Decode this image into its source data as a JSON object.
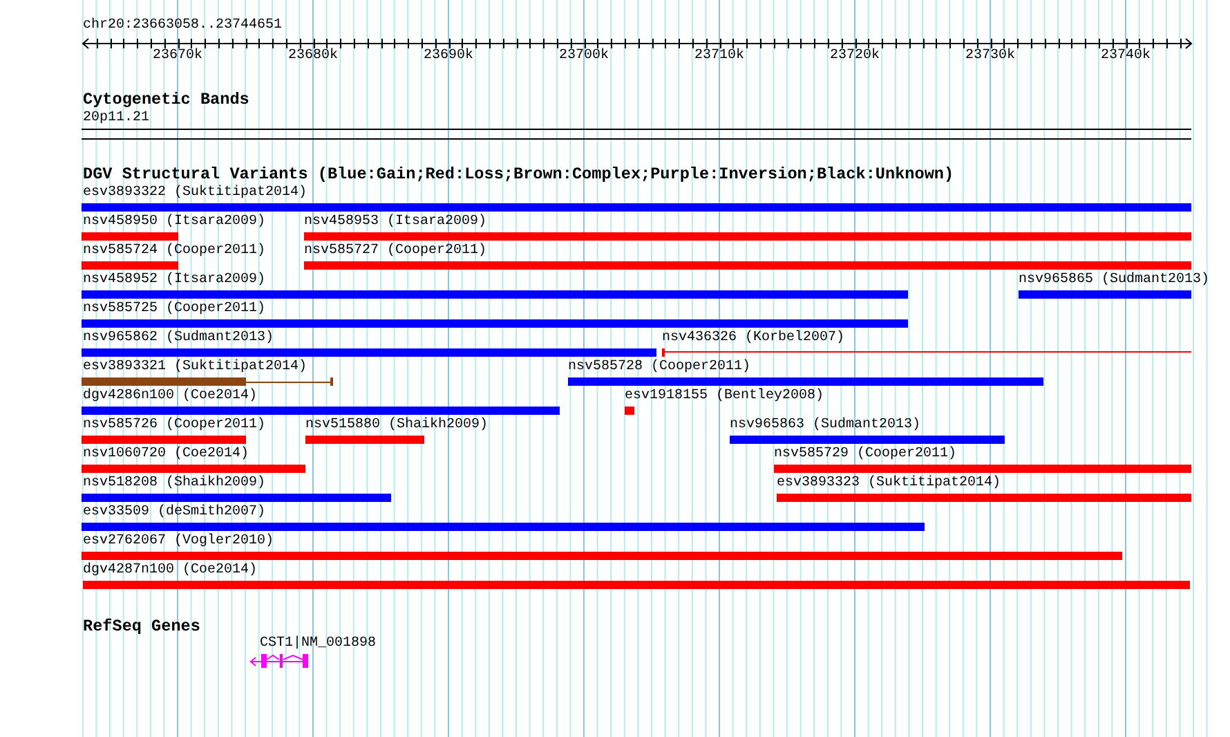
{
  "location": "chr20:23663058..23744651",
  "axis": {
    "ticks": [
      "23670k",
      "23680k",
      "23690k",
      "23700k",
      "23710k",
      "23720k",
      "23730k",
      "23740k"
    ]
  },
  "tracks": [
    {
      "title": "Cytogenetic Bands",
      "kind": "bands",
      "items": [
        {
          "label": "20p11.21"
        }
      ]
    },
    {
      "title": "DGV Structural Variants (Blue:Gain;Red:Loss;Brown:Complex;Purple:Inversion;Black:Unknown)",
      "kind": "variants",
      "lanes": [
        {
          "features": [
            {
              "label": "esv3893322 (Suktitipat2014)",
              "kind": "bar",
              "color": "#0000ff"
            }
          ]
        },
        {
          "features": [
            {
              "label": "nsv458950 (Itsara2009)",
              "kind": "bar",
              "color": "#ff0000"
            },
            {
              "label": "nsv458953 (Itsara2009)",
              "kind": "bar",
              "color": "#ff0000"
            }
          ]
        },
        {
          "features": [
            {
              "label": "nsv585724 (Cooper2011)",
              "kind": "bar",
              "color": "#ff0000"
            },
            {
              "label": "nsv585727 (Cooper2011)",
              "kind": "bar",
              "color": "#ff0000"
            }
          ]
        },
        {
          "features": [
            {
              "label": "nsv458952 (Itsara2009)",
              "kind": "bar",
              "color": "#0000ff"
            },
            {
              "label": "nsv965865 (Sudmant2013)",
              "kind": "bar",
              "color": "#0000ff"
            }
          ]
        },
        {
          "features": [
            {
              "label": "nsv585725 (Cooper2011)",
              "kind": "bar",
              "color": "#0000ff"
            }
          ]
        },
        {
          "features": [
            {
              "label": "nsv965862 (Sudmant2013)",
              "kind": "bar",
              "color": "#0000ff"
            },
            {
              "label": "nsv436326 (Korbel2007)",
              "kind": "thin",
              "color": "#ff0000"
            }
          ]
        },
        {
          "features": [
            {
              "label": "esv3893321 (Suktitipat2014)",
              "kind": "complex",
              "color": "#8b4513"
            },
            {
              "label": "nsv585728 (Cooper2011)",
              "kind": "bar",
              "color": "#0000ff"
            }
          ]
        },
        {
          "features": [
            {
              "label": "dgv4286n100 (Coe2014)",
              "kind": "bar",
              "color": "#0000ff"
            },
            {
              "label": "esv1918155 (Bentley2008)",
              "kind": "bar",
              "color": "#ff0000"
            }
          ]
        },
        {
          "features": [
            {
              "label": "nsv585726 (Cooper2011)",
              "kind": "bar",
              "color": "#ff0000"
            },
            {
              "label": "nsv515880 (Shaikh2009)",
              "kind": "bar",
              "color": "#ff0000"
            },
            {
              "label": "nsv965863 (Sudmant2013)",
              "kind": "bar",
              "color": "#0000ff"
            }
          ]
        },
        {
          "features": [
            {
              "label": "nsv1060720 (Coe2014)",
              "kind": "bar",
              "color": "#ff0000"
            },
            {
              "label": "nsv585729 (Cooper2011)",
              "kind": "bar",
              "color": "#ff0000"
            }
          ]
        },
        {
          "features": [
            {
              "label": "nsv518208 (Shaikh2009)",
              "kind": "bar",
              "color": "#0000ff"
            },
            {
              "label": "esv3893323 (Suktitipat2014)",
              "kind": "bar",
              "color": "#ff0000"
            }
          ]
        },
        {
          "features": [
            {
              "label": "esv33509 (deSmith2007)",
              "kind": "bar",
              "color": "#0000ff"
            }
          ]
        },
        {
          "features": [
            {
              "label": "esv2762067 (Vogler2010)",
              "kind": "bar",
              "color": "#ff0000"
            }
          ]
        },
        {
          "features": [
            {
              "label": "dgv4287n100 (Coe2014)",
              "kind": "bar",
              "color": "#ff0000"
            }
          ]
        }
      ]
    },
    {
      "title": "RefSeq Genes",
      "kind": "genes",
      "genes": [
        {
          "label": "CST1|NM_001898",
          "color": "#ff00ff"
        }
      ]
    }
  ]
}
